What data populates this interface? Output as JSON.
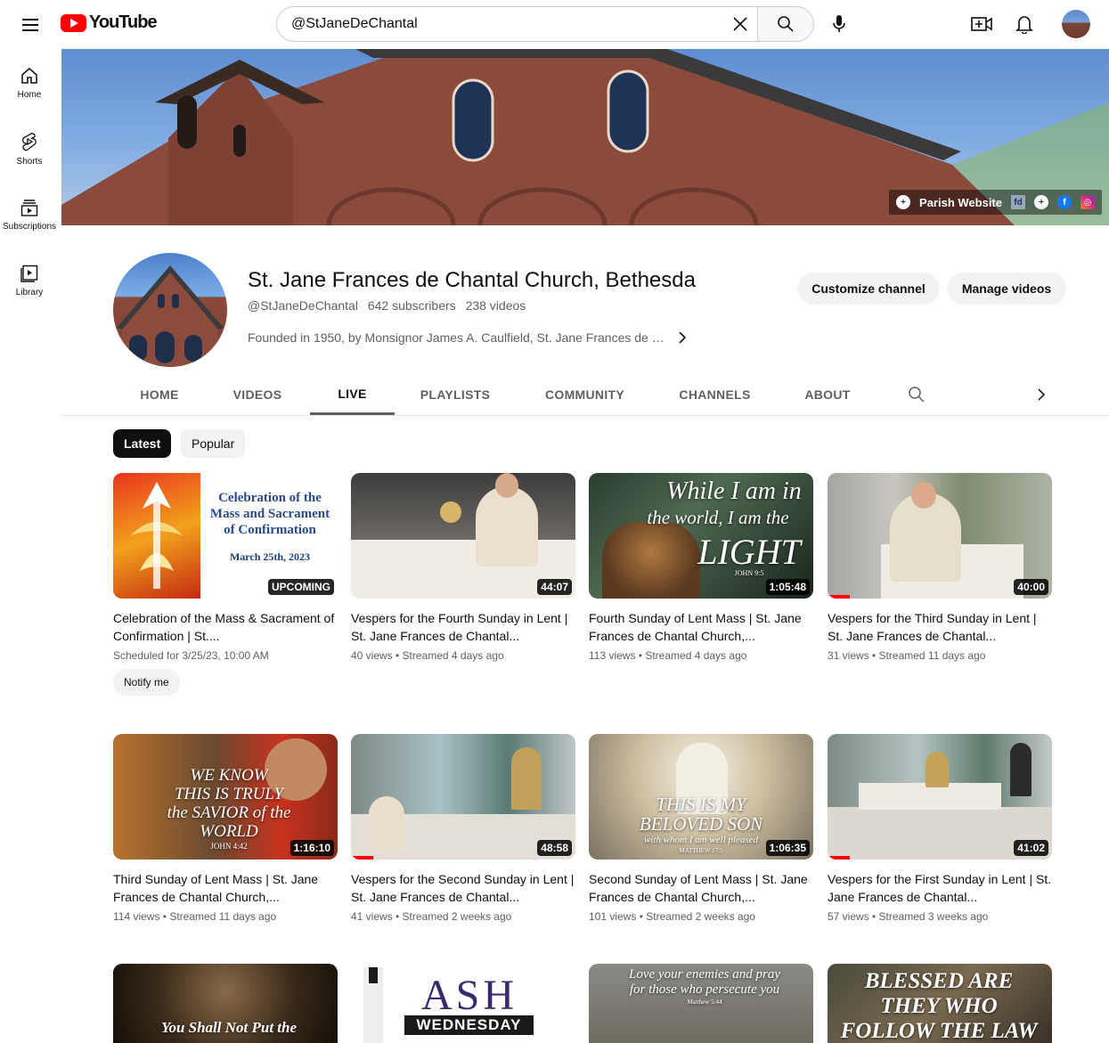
{
  "topbar": {
    "logo_text": "YouTube",
    "search_value": "@StJaneDeChantal"
  },
  "sidebar": {
    "items": [
      {
        "label": "Home",
        "icon": "home-icon"
      },
      {
        "label": "Shorts",
        "icon": "shorts-icon"
      },
      {
        "label": "Subscriptions",
        "icon": "subscriptions-icon"
      },
      {
        "label": "Library",
        "icon": "library-icon"
      }
    ]
  },
  "banner": {
    "link_label": "Parish Website",
    "extra_icons": [
      "fd-icon",
      "add-icon",
      "facebook-icon",
      "instagram-icon"
    ]
  },
  "channel": {
    "title": "St. Jane Frances de Chantal Church, Bethesda",
    "handle": "@StJaneDeChantal",
    "subscribers": "642 subscribers",
    "videos": "238 videos",
    "description": "Founded in 1950, by Monsignor James A. Caulfield, St. Jane Frances de C...",
    "customize_label": "Customize channel",
    "manage_label": "Manage videos"
  },
  "tabs": [
    "HOME",
    "VIDEOS",
    "LIVE",
    "PLAYLISTS",
    "COMMUNITY",
    "CHANNELS",
    "ABOUT"
  ],
  "active_tab": "LIVE",
  "chips": {
    "latest": "Latest",
    "popular": "Popular"
  },
  "videos": [
    {
      "title": "Celebration of the Mass & Sacrament of Confirmation | St....",
      "meta": "Scheduled for 3/25/23, 10:00 AM",
      "badge": "UPCOMING",
      "action": "Notify me",
      "thumb_lines": [
        "Celebration of the",
        "Mass and Sacrament",
        "of Confirmation",
        "March 25th, 2023"
      ]
    },
    {
      "title": "Vespers for the Fourth Sunday in Lent | St. Jane Frances de Chantal...",
      "meta": "40 views • Streamed 4 days ago",
      "badge": "44:07"
    },
    {
      "title": "Fourth Sunday of Lent Mass | St. Jane Frances de Chantal Church,...",
      "meta": "113 views • Streamed 4 days ago",
      "badge": "1:05:48",
      "thumb_lines": [
        "While I am in",
        "the world, I am the",
        "LIGHT",
        "JOHN 9:5"
      ]
    },
    {
      "title": "Vespers for the Third Sunday in Lent | St. Jane Frances de Chantal...",
      "meta": "31 views • Streamed 11 days ago",
      "badge": "40:00",
      "progress": 0.1
    },
    {
      "title": "Third Sunday of Lent Mass | St. Jane Frances de Chantal Church,...",
      "meta": "114 views • Streamed 11 days ago",
      "badge": "1:16:10",
      "thumb_lines": [
        "WE KNOW",
        "THIS IS TRULY",
        "the SAVIOR of the",
        "WORLD",
        "JOHN 4:42"
      ]
    },
    {
      "title": "Vespers for the Second Sunday in Lent | St. Jane Frances de Chantal...",
      "meta": "41 views • Streamed 2 weeks ago",
      "badge": "48:58",
      "progress": 0.1
    },
    {
      "title": "Second Sunday of Lent Mass | St. Jane Frances de Chantal Church,...",
      "meta": "101 views • Streamed 2 weeks ago",
      "badge": "1:06:35",
      "thumb_lines": [
        "THIS IS MY",
        "BELOVED SON",
        "with whom I am well pleased",
        "MATTHEW 17:5"
      ]
    },
    {
      "title": "Vespers for the First Sunday in Lent | St. Jane Frances de Chantal...",
      "meta": "57 views • Streamed 3 weeks ago",
      "badge": "41:02",
      "progress": 0.1
    },
    {
      "thumb_lines": [
        "You Shall Not Put the"
      ]
    },
    {
      "thumb_lines": [
        "ASH",
        "WEDNESDAY"
      ]
    },
    {
      "thumb_lines": [
        "Love your enemies and pray",
        "for those who persecute you",
        "Matthew 5:44"
      ]
    },
    {
      "thumb_lines": [
        "BLESSED ARE",
        "THEY WHO",
        "FOLLOW THE LAW"
      ]
    }
  ],
  "colors": {
    "accent": "#ff0000",
    "text_primary": "#0f0f0f",
    "text_secondary": "#606060",
    "chip_bg": "#f2f2f2"
  }
}
